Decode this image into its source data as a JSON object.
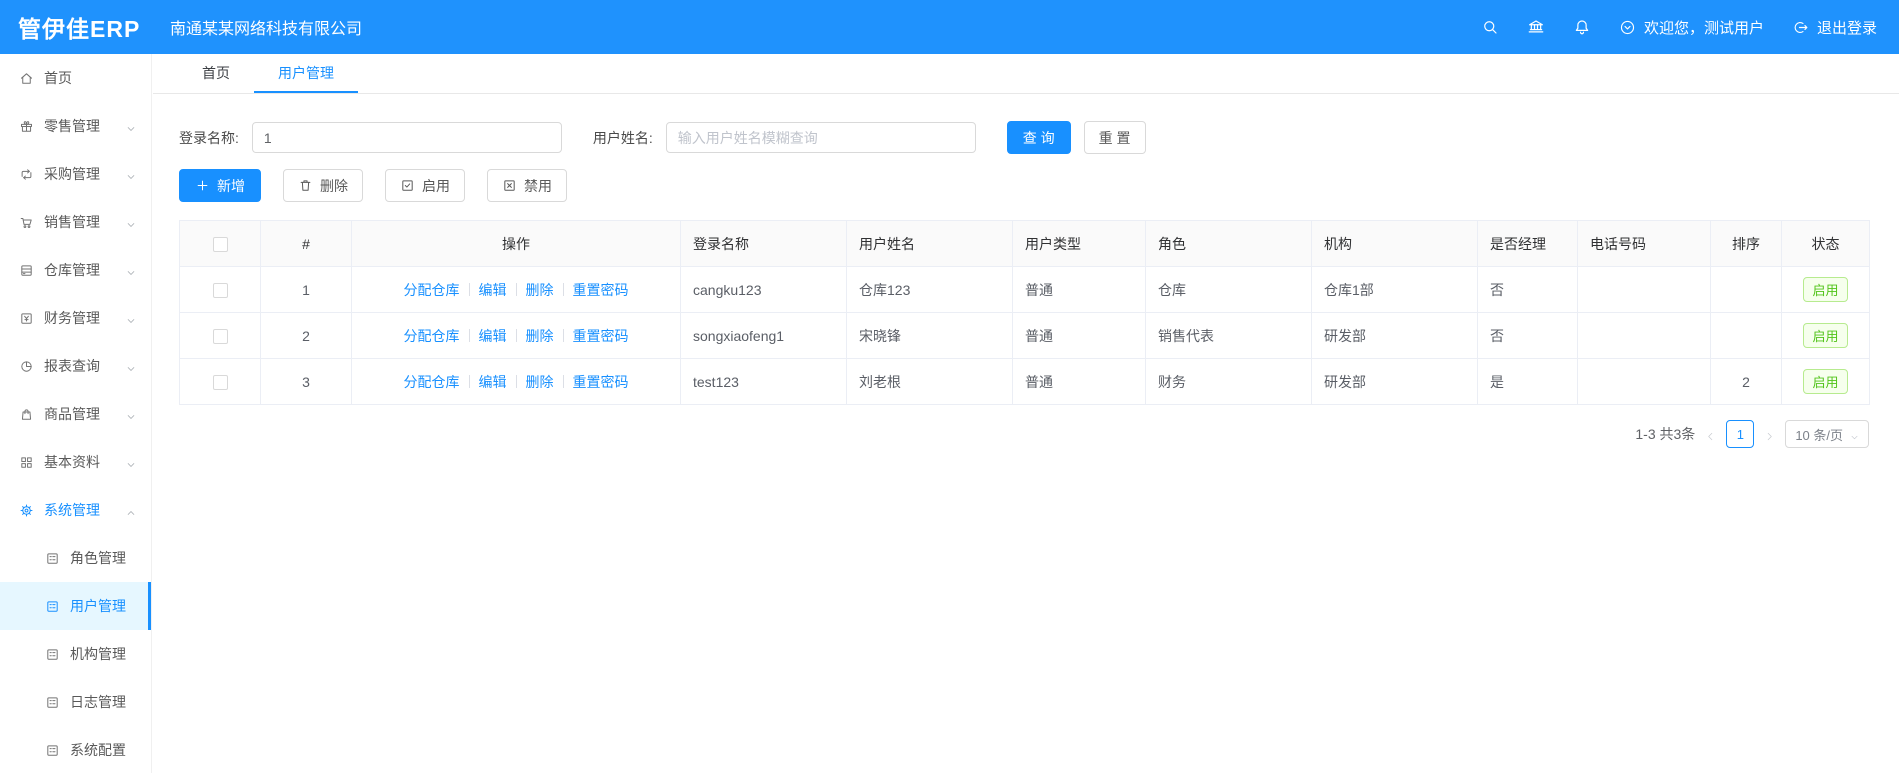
{
  "app": {
    "logo": "管伊佳ERP",
    "company": "南通某某网络科技有限公司"
  },
  "header": {
    "welcome": "欢迎您，测试用户",
    "logout": "退出登录",
    "icons": [
      "search-icon",
      "bank-icon",
      "bell-icon",
      "down-circle-icon",
      "logout-icon"
    ]
  },
  "sidebar": {
    "items": [
      {
        "label": "首页",
        "icon": "home-icon"
      },
      {
        "label": "零售管理",
        "icon": "gift-icon"
      },
      {
        "label": "采购管理",
        "icon": "sync-icon"
      },
      {
        "label": "销售管理",
        "icon": "cart-icon"
      },
      {
        "label": "仓库管理",
        "icon": "warehouse-icon"
      },
      {
        "label": "财务管理",
        "icon": "finance-icon"
      },
      {
        "label": "报表查询",
        "icon": "pie-chart-icon"
      },
      {
        "label": "商品管理",
        "icon": "shopping-bag-icon"
      },
      {
        "label": "基本资料",
        "icon": "grid-icon"
      },
      {
        "label": "系统管理",
        "icon": "gear-icon"
      }
    ],
    "sub_items": [
      {
        "label": "角色管理"
      },
      {
        "label": "用户管理"
      },
      {
        "label": "机构管理"
      },
      {
        "label": "日志管理"
      },
      {
        "label": "系统配置"
      }
    ],
    "active_item": "系统管理",
    "active_sub_item": "用户管理"
  },
  "tabs": [
    {
      "label": "首页"
    },
    {
      "label": "用户管理"
    }
  ],
  "filters": {
    "login_label": "登录名称:",
    "login_value": "1",
    "name_label": "用户姓名:",
    "name_placeholder": "输入用户姓名模糊查询",
    "query_button": "查 询",
    "reset_button": "重 置"
  },
  "toolbar": {
    "add": "新增",
    "delete": "删除",
    "enable": "启用",
    "disable": "禁用"
  },
  "table": {
    "headers": [
      "#",
      "操作",
      "登录名称",
      "用户姓名",
      "用户类型",
      "角色",
      "机构",
      "是否经理",
      "电话号码",
      "排序",
      "状态"
    ],
    "action_links": [
      "分配仓库",
      "编辑",
      "删除",
      "重置密码"
    ],
    "rows": [
      {
        "index": "1",
        "login": "cangku123",
        "name": "仓库123",
        "type": "普通",
        "role": "仓库",
        "org": "仓库1部",
        "manager": "否",
        "phone": "",
        "sort": "",
        "status": "启用"
      },
      {
        "index": "2",
        "login": "songxiaofeng1",
        "name": "宋晓锋",
        "type": "普通",
        "role": "销售代表",
        "org": "研发部",
        "manager": "否",
        "phone": "",
        "sort": "",
        "status": "启用"
      },
      {
        "index": "3",
        "login": "test123",
        "name": "刘老根",
        "type": "普通",
        "role": "财务",
        "org": "研发部",
        "manager": "是",
        "phone": "",
        "sort": "2",
        "status": "启用"
      }
    ]
  },
  "pagination": {
    "total": "1-3 共3条",
    "current_page": "1",
    "page_size": "10 条/页"
  },
  "colors": {
    "primary": "#1890ff",
    "header_bg": "#1f92fd",
    "active_bg": "#e6f7ff",
    "status_green": "#52c41a"
  }
}
